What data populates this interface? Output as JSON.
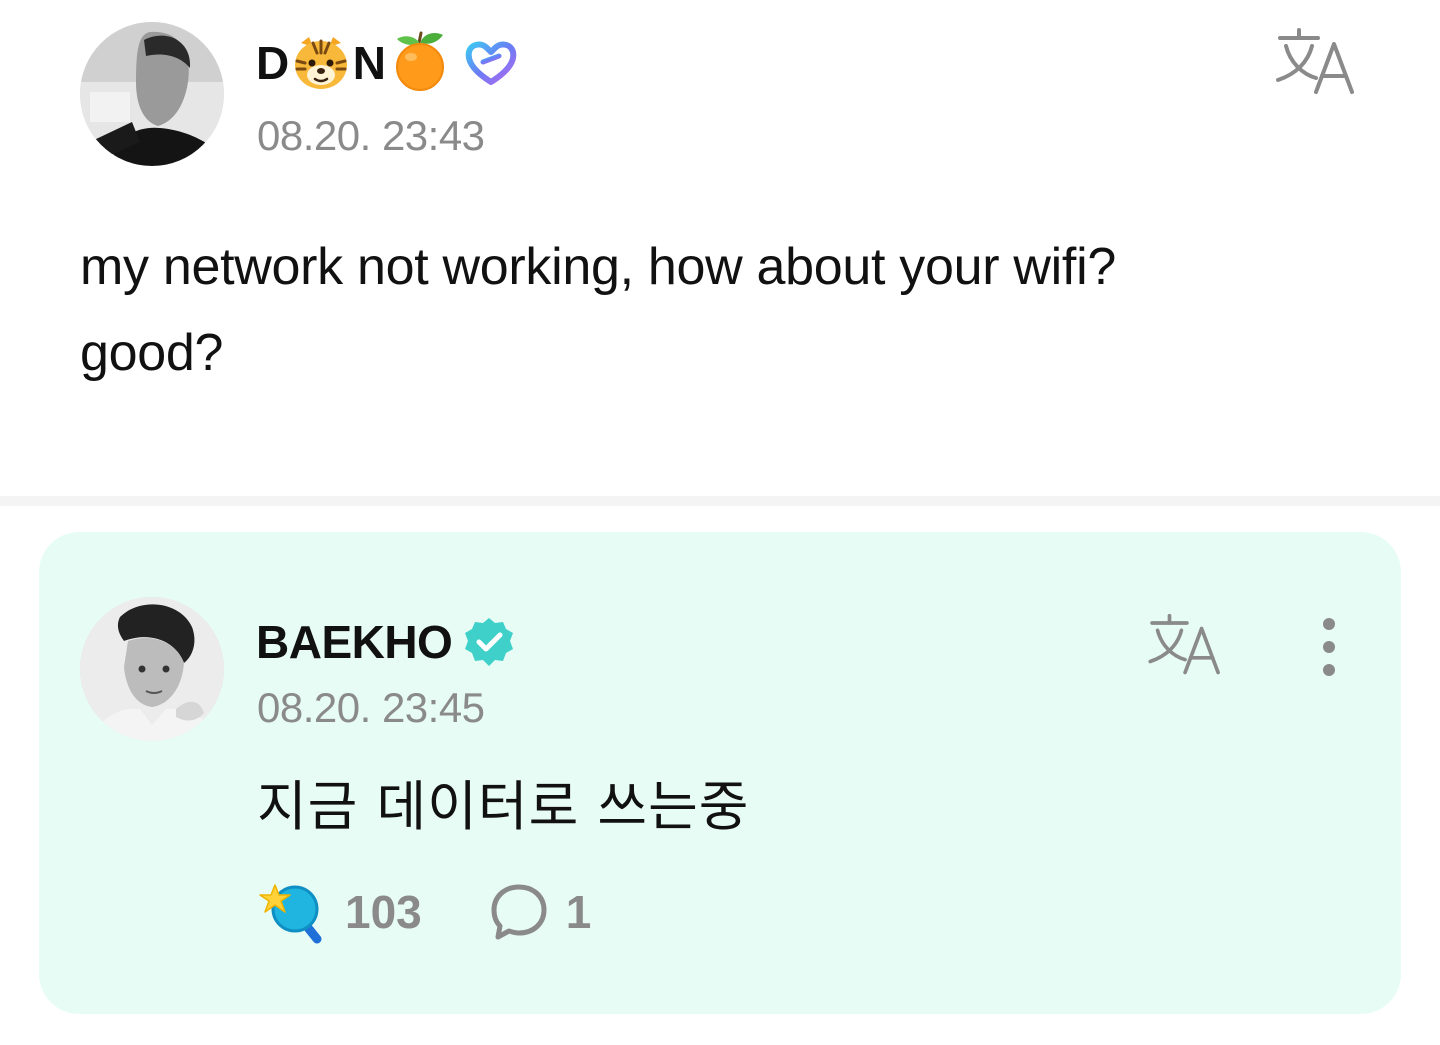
{
  "post": {
    "author": {
      "name_prefix": "D",
      "name_suffix": "N",
      "avatar": "grayscale-portrait-photo"
    },
    "timestamp": "08.20. 23:43",
    "body": [
      "my network not working, how about your wifi?",
      "good?"
    ],
    "icons": {
      "name_decoration_1": "tiger-face-icon",
      "name_decoration_2": "tangerine-icon",
      "badge": "heart-badge-icon",
      "translate": "translate-icon"
    }
  },
  "reply": {
    "author": {
      "name": "BAEKHO",
      "verified": true,
      "avatar": "grayscale-portrait-photo"
    },
    "timestamp": "08.20. 23:45",
    "body": "지금 데이터로 쓰는중",
    "likes": "103",
    "comments": "1",
    "icons": {
      "translate": "translate-icon",
      "more": "more-vertical-icon",
      "like": "lightstick-icon",
      "comment": "comment-bubble-icon"
    }
  },
  "colors": {
    "reply_card_bg": "#e8fcf6",
    "verified_badge": "#3fd0c9",
    "muted_text": "#8a8a8a",
    "divider": "#f4f4f5"
  }
}
